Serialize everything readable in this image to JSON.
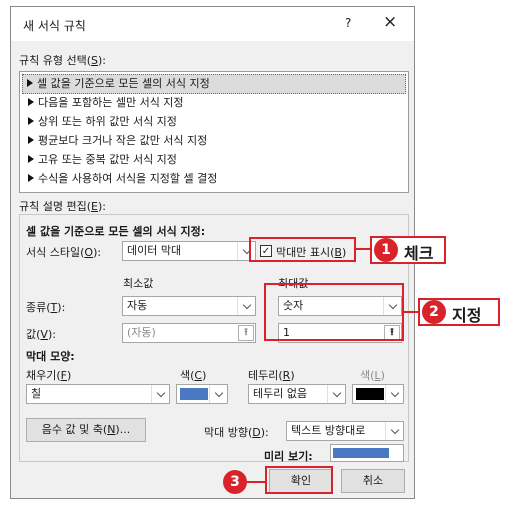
{
  "dialog": {
    "title": "새 서식 규칙",
    "help": "?",
    "close": "×"
  },
  "rule_type": {
    "label_pre": "규칙 유형 선택(",
    "label_key": "S",
    "label_post": "):",
    "items": [
      "셀 값을 기준으로 모든 셀의 서식 지정",
      "다음을 포함하는 셀만 서식 지정",
      "상위 또는 하위 값만 서식 지정",
      "평균보다 크거나 작은 값만 서식 지정",
      "고유 또는 중복 값만 서식 지정",
      "수식을 사용하여 서식을 지정할 셀 결정"
    ],
    "selected_index": 0
  },
  "rule_edit": {
    "label_pre": "규칙 설명 편집(",
    "label_key": "E",
    "label_post": "):",
    "heading": "셀 값을 기준으로 모든 셀의 서식 지정:",
    "style_label_pre": "서식 스타일(",
    "style_label_key": "O",
    "style_label_post": "):",
    "style_value": "데이터 막대",
    "bar_only_pre": "막대만 표시(",
    "bar_only_key": "B",
    "bar_only_post": ")",
    "bar_only_checked": true,
    "min_header": "최소값",
    "max_header": "최대값",
    "type_label_pre": "종류(",
    "type_label_key": "T",
    "type_label_post": "):",
    "min_type": "자동",
    "max_type": "숫자",
    "value_label_pre": "값(",
    "value_label_key": "V",
    "value_label_post": "):",
    "min_value": "(자동)",
    "max_value": "1",
    "ref_icon": "⇞"
  },
  "bar_appearance": {
    "heading": "막대 모양:",
    "fill_label_pre": "채우기(",
    "fill_label_key": "F",
    "fill_label_post": ")",
    "fill_value": "칠",
    "color_label_pre": "색(",
    "color_label_key": "C",
    "color_label_post": ")",
    "bar_color": "#4a79c4",
    "border_label_pre": "테두리(",
    "border_label_key": "R",
    "border_label_post": ")",
    "border_value": "테두리 없음",
    "border_color_label_pre": "색(",
    "border_color_label_key": "L",
    "border_color_label_post": ")",
    "border_color": "#000000",
    "neg_button_pre": "음수 값 및 축(",
    "neg_button_key": "N",
    "neg_button_post": ")...",
    "direction_label_pre": "막대 방향(",
    "direction_label_key": "D",
    "direction_label_post": "):",
    "direction_value": "텍스트 방향대로",
    "preview_label": "미리 보기:"
  },
  "buttons": {
    "ok": "확인",
    "cancel": "취소"
  },
  "callouts": [
    {
      "number": "1",
      "text": "체크"
    },
    {
      "number": "2",
      "text": "지정"
    },
    {
      "number": "3",
      "text": ""
    }
  ],
  "colors": {
    "accent_red": "#d9232a"
  }
}
